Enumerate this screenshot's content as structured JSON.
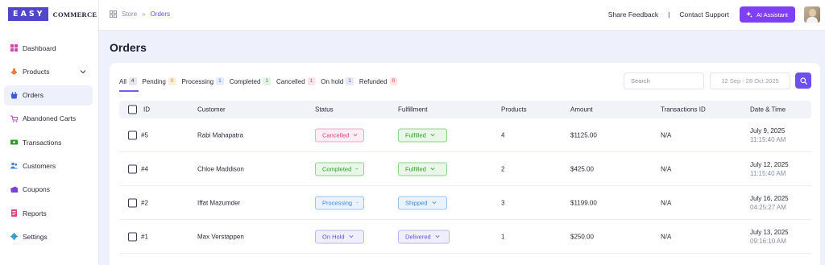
{
  "logo": {
    "box": "EASY",
    "text": "COMMERCE"
  },
  "sidebar": {
    "items": [
      {
        "label": "Dashboard",
        "icon": "dashboard-icon",
        "color": "#d63fb5"
      },
      {
        "label": "Products",
        "icon": "products-icon",
        "color": "#f07a3a"
      },
      {
        "label": "Orders",
        "icon": "orders-icon",
        "color": "#3b5bdb"
      },
      {
        "label": "Abandoned Carts",
        "icon": "cart-icon",
        "color": "#c23fd6"
      },
      {
        "label": "Transactions",
        "icon": "transactions-icon",
        "color": "#2f9a2a"
      },
      {
        "label": "Customers",
        "icon": "customers-icon",
        "color": "#3f86d9"
      },
      {
        "label": "Coupons",
        "icon": "coupons-icon",
        "color": "#7a3fe0"
      },
      {
        "label": "Reports",
        "icon": "reports-icon",
        "color": "#e0457a"
      },
      {
        "label": "Settings",
        "icon": "settings-icon",
        "color": "#2c9ad6"
      }
    ],
    "active": "Orders"
  },
  "header": {
    "breadcrumb": {
      "store": "Store",
      "current": "Orders"
    },
    "share_feedback": "Share Feedback",
    "divider": "|",
    "contact_support": "Contact Support",
    "ai_assistant": "AI Assistant"
  },
  "page": {
    "title": "Orders"
  },
  "tabs": [
    {
      "label": "All",
      "count": "4",
      "bg": "#e6e7ef",
      "fg": "#3a3a4a"
    },
    {
      "label": "Pending",
      "count": "0",
      "bg": "#fdf0d9",
      "fg": "#c98a1a"
    },
    {
      "label": "Processing",
      "count": "1",
      "bg": "#e3edfb",
      "fg": "#3f86d9"
    },
    {
      "label": "Completed",
      "count": "1",
      "bg": "#e3f5e2",
      "fg": "#2f9a2a"
    },
    {
      "label": "Cancelled",
      "count": "1",
      "bg": "#fde3ea",
      "fg": "#e0457a"
    },
    {
      "label": "On hold",
      "count": "1",
      "bg": "#e6e8fb",
      "fg": "#5c56c9"
    },
    {
      "label": "Refunded",
      "count": "0",
      "bg": "#fde3e3",
      "fg": "#d94040"
    }
  ],
  "search": {
    "placeholder": "Search"
  },
  "daterange": {
    "value": "12 Sep - 28 Oct 2025"
  },
  "table": {
    "columns": [
      "ID",
      "Customer",
      "Status",
      "Fulfillment",
      "Products",
      "Amount",
      "Transactions ID",
      "Date & Time"
    ],
    "rows": [
      {
        "id": "#5",
        "customer": "Rabi Mahapatra",
        "status": "Cancelled",
        "status_class": "st-cancelled",
        "fulfillment": "Fulfilled",
        "ff_class": "ff-fulfilled",
        "products": "4",
        "amount": "$1125.00",
        "txn": "N/A",
        "date": "July 9, 2025",
        "time": "11:15:40 AM"
      },
      {
        "id": "#4",
        "customer": "Chloe Maddison",
        "status": "Completed",
        "status_class": "st-completed",
        "fulfillment": "Fulfilled",
        "ff_class": "ff-fulfilled",
        "products": "2",
        "amount": "$425.00",
        "txn": "N/A",
        "date": "July 12, 2025",
        "time": "11:15:40 AM"
      },
      {
        "id": "#2",
        "customer": "Iffat Mazumder",
        "status": "Processing",
        "status_class": "st-processing",
        "fulfillment": "Shipped",
        "ff_class": "ff-shipped",
        "products": "3",
        "amount": "$1199.00",
        "txn": "N/A",
        "date": "July 16, 2025",
        "time": "04:25:27 AM"
      },
      {
        "id": "#1",
        "customer": "Max Verstappen",
        "status": "On Hold",
        "status_class": "st-onhold",
        "fulfillment": "Delivered",
        "ff_class": "ff-delivered",
        "products": "1",
        "amount": "$250.00",
        "txn": "N/A",
        "date": "July 13, 2025",
        "time": "09:16:10 AM"
      }
    ]
  }
}
